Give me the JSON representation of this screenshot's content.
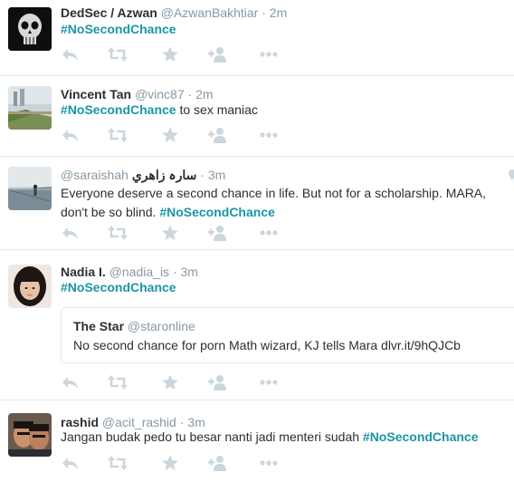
{
  "tweets": [
    {
      "name": "DedSec / Azwan",
      "handle": "@AzwanBakhtiar",
      "sep": "·",
      "time": "2m",
      "hashtag": "#NoSecondChance",
      "text_after": ""
    },
    {
      "name": "Vincent Tan",
      "handle": "@vinc87",
      "sep": "·",
      "time": "2m",
      "hashtag": "#NoSecondChance",
      "text_after": " to sex maniac"
    },
    {
      "name": "سارہ زاهري",
      "handle": "@saraishah",
      "sep": "·",
      "time": "3m",
      "text_line1": "Everyone deserve a second chance in life. But not for a scholarship. MARA,",
      "text_line2_prefix": "don't be so blind. ",
      "hashtag": "#NoSecondChance"
    },
    {
      "name": "Nadia I.",
      "handle": "@nadia_is",
      "sep": "·",
      "time": "3m",
      "hashtag": "#NoSecondChance",
      "quote": {
        "name": "The Star",
        "handle": "@staronline",
        "text": "No second chance for porn Math wizard, KJ tells Mara dlvr.it/9hQJCb"
      }
    },
    {
      "name": "rashid",
      "handle": "@acit_rashid",
      "sep": "·",
      "time": "3m",
      "text_before": "Jangan budak pedo tu besar nanti jadi menteri sudah ",
      "hashtag": "#NoSecondChance"
    }
  ],
  "icons": [
    "reply-icon",
    "retweet-icon",
    "favorite-icon",
    "follow-icon",
    "more-icon"
  ],
  "colors": {
    "hashtag": "#1b95a5",
    "muted": "#8899a6",
    "text": "#292f33",
    "icon": "#ccd6dd",
    "border": "#e1e8ed"
  }
}
